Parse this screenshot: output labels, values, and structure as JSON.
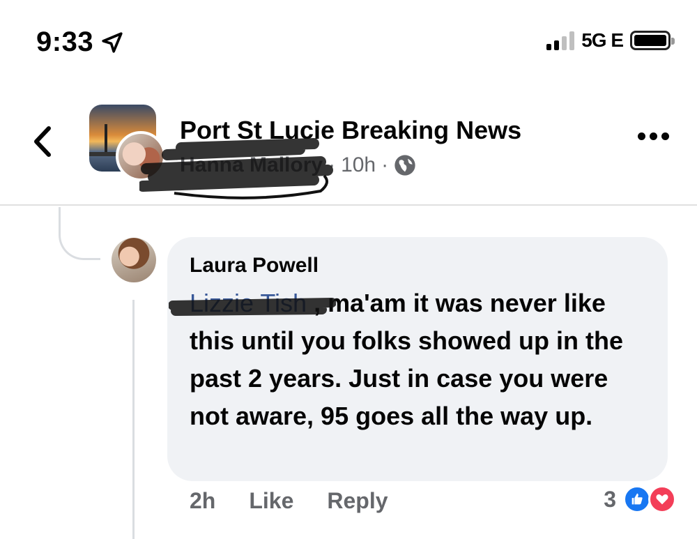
{
  "status_bar": {
    "time": "9:33",
    "network": "5G E",
    "location_icon": "location-arrow-icon",
    "signal_icon": "signal-bars-icon",
    "battery_icon": "battery-icon"
  },
  "header": {
    "group_name": "Port St Lucie Breaking News",
    "author": "Hanna Mallory",
    "time_ago": "10h",
    "separator": "·",
    "privacy_icon": "globe-icon",
    "back_icon": "chevron-left-icon",
    "more_icon": "more-dots-icon"
  },
  "comment": {
    "author": "Laura Powell",
    "mention": "Lizzie Tish",
    "text": " , ma'am it was never like this until you folks showed up in the past 2 years. Just in case you were not aware, 95 goes all the way up.",
    "time_ago": "2h",
    "like_label": "Like",
    "reply_label": "Reply",
    "reaction_count": "3",
    "reactions": [
      "like",
      "love"
    ]
  },
  "colors": {
    "mention": "#385898",
    "secondary_text": "#65676b",
    "bubble_bg": "#f0f2f5",
    "like_blue": "#1877f2",
    "love_red": "#f33e58"
  }
}
